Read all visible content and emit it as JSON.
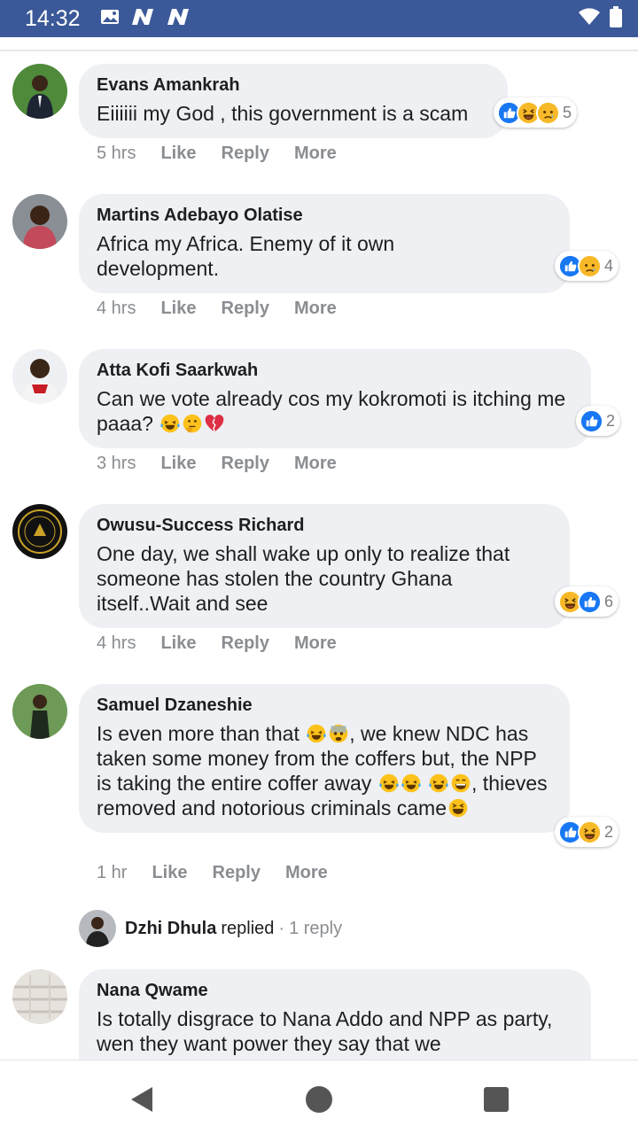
{
  "status_bar": {
    "time": "14:32",
    "left_icons": [
      "image-icon",
      "n-logo-icon",
      "n-logo-icon"
    ],
    "right_icons": [
      "wifi-icon",
      "battery-icon"
    ],
    "color": "#3b5998"
  },
  "comments": [
    {
      "author": "Evans Amankrah",
      "text": "Eiiiiii my God , this government is a scam",
      "inline_emojis": [],
      "reactions": [
        "like",
        "haha",
        "sad"
      ],
      "reaction_count": "5",
      "time": "5 hrs",
      "like": "Like",
      "reply": "Reply",
      "more": "More"
    },
    {
      "author": "Martins Adebayo Olatise",
      "text": "Africa my Africa. Enemy of it own development.",
      "inline_emojis": [],
      "reactions": [
        "like",
        "sad"
      ],
      "reaction_count": "4",
      "time": "4 hrs",
      "like": "Like",
      "reply": "Reply",
      "more": "More"
    },
    {
      "author": "Atta Kofi Saarkwah",
      "text": "Can we vote already cos my kokromoti is itching me paaa?",
      "inline_emojis": [
        "joy",
        "thinking",
        "broken-heart"
      ],
      "reactions": [
        "like"
      ],
      "reaction_count": "2",
      "time": "3 hrs",
      "like": "Like",
      "reply": "Reply",
      "more": "More"
    },
    {
      "author": "Owusu-Success Richard",
      "text": "One day, we shall wake up only to realize that someone has stolen the country Ghana itself..Wait and see",
      "inline_emojis": [],
      "reactions": [
        "haha",
        "like"
      ],
      "reaction_count": "6",
      "time": "4 hrs",
      "like": "Like",
      "reply": "Reply",
      "more": "More"
    },
    {
      "author": "Samuel Dzaneshie",
      "text_parts": [
        "Is even more than that",
        ", we knew NDC has taken some money from the coffers but, the NPP is taking the entire coffer away",
        ", thieves removed and notorious criminals came"
      ],
      "inline_emojis": [
        "joy",
        "fearful",
        "joy",
        "joy",
        "joy",
        "grin",
        "laughing"
      ],
      "reactions": [
        "like",
        "haha"
      ],
      "reaction_count": "2",
      "time": "1 hr",
      "like": "Like",
      "reply": "Reply",
      "more": "More",
      "replies": {
        "name": "Dzhi Dhula",
        "replied_label": "replied",
        "separator": "·",
        "count_label": "1 reply"
      }
    },
    {
      "author": "Nana Qwame",
      "text": "Is totally disgrace to Nana Addo and NPP as party, wen they want power they say that we"
    }
  ],
  "nav": {
    "back_icon": "back-triangle-icon",
    "home_icon": "home-circle-icon",
    "recents_icon": "recents-square-icon"
  },
  "colors": {
    "bubble": "#eef0f3",
    "like_blue": "#1877f2",
    "haha_yellow": "#f7b928",
    "meta_gray": "#8a8d91"
  }
}
